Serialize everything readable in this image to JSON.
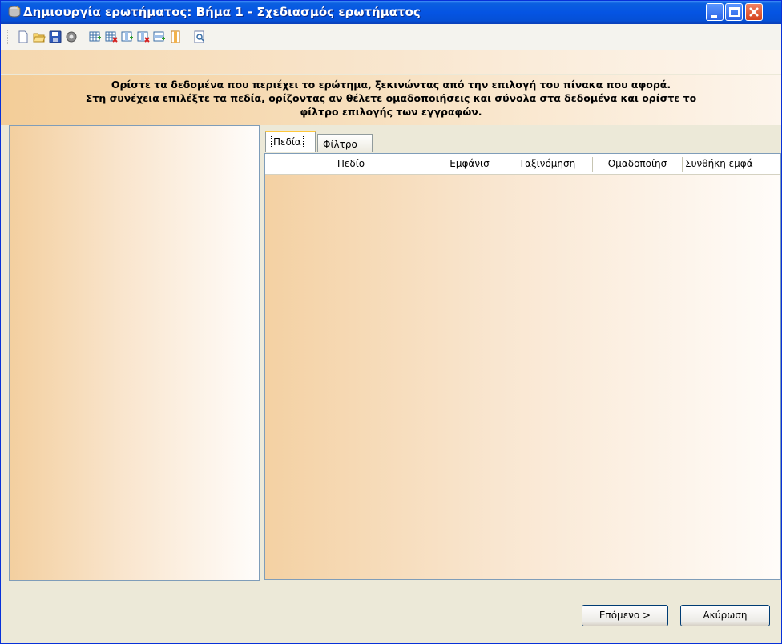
{
  "window": {
    "title": "Δημιουργία ερωτήματος: Βήμα 1 - Σχεδιασμός ερωτήματος",
    "controls": [
      "minimize",
      "maximize",
      "close"
    ]
  },
  "toolbar": {
    "icons": [
      "new-icon",
      "open-icon",
      "save-icon",
      "settings-icon",
      "add-table-icon",
      "remove-table-icon",
      "add-field-icon",
      "remove-field-icon",
      "add-row-icon",
      "columns-icon",
      "preview-icon"
    ]
  },
  "instructions": {
    "line1": "Ορίστε τα δεδομένα που περιέχει το ερώτημα, ξεκινώντας από την επιλογή του πίνακα που αφορά.",
    "line2": "Στη συνέχεια επιλέξτε τα πεδία, ορίζοντας αν θέλετε ομαδοποιήσεις και σύνολα στα δεδομένα και ορίστε το",
    "line3": "φίλτρο επιλογής των εγγραφών."
  },
  "tabs": [
    {
      "label": "Πεδία",
      "selected": true
    },
    {
      "label": "Φίλτρο",
      "selected": false
    }
  ],
  "grid": {
    "columns": [
      "Πεδίο",
      "Εμφάνισ",
      "Ταξινόμηση",
      "Ομαδοποίησ",
      "Συνθήκη εμφά"
    ]
  },
  "buttons": {
    "next": "Επόμενο >",
    "cancel": "Ακύρωση"
  },
  "colors": {
    "titlebar": "#0554e3",
    "panel_gradient_start": "#f3cf9f",
    "panel_gradient_end": "#ffffff"
  }
}
